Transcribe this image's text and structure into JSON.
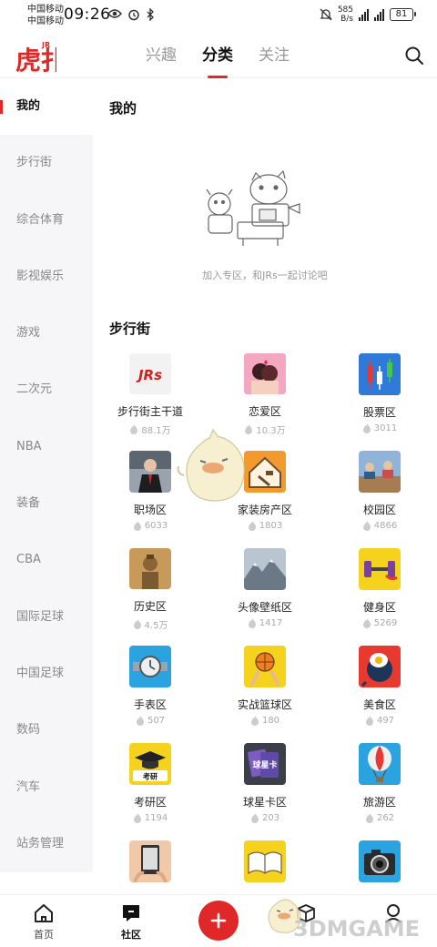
{
  "status_bar": {
    "carrier_1": "中国移动",
    "carrier_2": "中国移动",
    "time": "09:26",
    "net_speed_value": "585",
    "net_speed_unit": "B/s",
    "battery": "81"
  },
  "header": {
    "tabs": [
      {
        "label": "兴趣",
        "active": false
      },
      {
        "label": "分类",
        "active": true
      },
      {
        "label": "关注",
        "active": false
      }
    ]
  },
  "sidebar": {
    "items": [
      {
        "label": "我的",
        "active": true
      },
      {
        "label": "步行街"
      },
      {
        "label": "综合体育"
      },
      {
        "label": "影视娱乐"
      },
      {
        "label": "游戏"
      },
      {
        "label": "二次元"
      },
      {
        "label": "NBA"
      },
      {
        "label": "装备"
      },
      {
        "label": "CBA"
      },
      {
        "label": "国际足球"
      },
      {
        "label": "中国足球"
      },
      {
        "label": "数码"
      },
      {
        "label": "汽车"
      },
      {
        "label": "站务管理"
      }
    ]
  },
  "mine": {
    "title": "我的",
    "empty_text": "加入专区，和JRs一起讨论吧"
  },
  "buxingjie": {
    "title": "步行街",
    "boards": [
      {
        "name": "步行街主干道",
        "count": "88.1万",
        "icon": "jrs-logo-icon"
      },
      {
        "name": "恋爱区",
        "count": "10.3万",
        "icon": "couple-icon"
      },
      {
        "name": "股票区",
        "count": "3011",
        "icon": "stock-candles-icon"
      },
      {
        "name": "职场区",
        "count": "6033",
        "icon": "office-worker-icon"
      },
      {
        "name": "家装房产区",
        "count": "1803",
        "icon": "house-tools-icon"
      },
      {
        "name": "校园区",
        "count": "4866",
        "icon": "classroom-icon"
      },
      {
        "name": "历史区",
        "count": "4.5万",
        "icon": "terracotta-warrior-icon"
      },
      {
        "name": "头像壁纸区",
        "count": "1417",
        "icon": "mountain-wallpaper-icon"
      },
      {
        "name": "健身区",
        "count": "5269",
        "icon": "dumbbell-icon"
      },
      {
        "name": "手表区",
        "count": "507",
        "icon": "watch-icon"
      },
      {
        "name": "实战篮球区",
        "count": "180",
        "icon": "basketball-icon"
      },
      {
        "name": "美食区",
        "count": "497",
        "icon": "fried-egg-pan-icon"
      },
      {
        "name": "考研区",
        "count": "1194",
        "icon": "graduation-cap-icon"
      },
      {
        "name": "球星卡区",
        "count": "203",
        "icon": "trading-card-icon"
      },
      {
        "name": "旅游区",
        "count": "262",
        "icon": "hot-air-balloon-icon"
      },
      {
        "name": "",
        "count": "",
        "icon": "ebook-reader-icon"
      },
      {
        "name": "",
        "count": "",
        "icon": "open-book-icon"
      },
      {
        "name": "",
        "count": "",
        "icon": "camera-icon"
      }
    ],
    "icon_label_jrs": "JRs",
    "icon_label_kaoyan": "考研",
    "icon_label_card": "球星卡"
  },
  "bottom_nav": {
    "items": [
      {
        "label": "首页",
        "icon": "home-icon"
      },
      {
        "label": "社区",
        "icon": "community-icon",
        "active": true
      },
      {
        "label": "",
        "icon": "plus-icon"
      },
      {
        "label": "",
        "icon": "box-icon"
      },
      {
        "label": "",
        "icon": "profile-icon"
      }
    ]
  },
  "overlay": {
    "watermark": "3DMGAME"
  },
  "colors": {
    "accent_red": "#e02828",
    "sidebar_bg": "#f6f6f8",
    "muted_text": "#999999"
  }
}
